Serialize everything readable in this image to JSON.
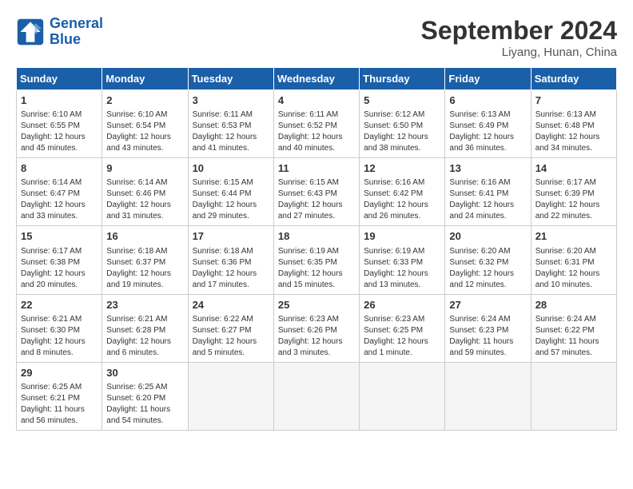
{
  "header": {
    "logo_line1": "General",
    "logo_line2": "Blue",
    "month_title": "September 2024",
    "location": "Liyang, Hunan, China"
  },
  "days_of_week": [
    "Sunday",
    "Monday",
    "Tuesday",
    "Wednesday",
    "Thursday",
    "Friday",
    "Saturday"
  ],
  "weeks": [
    [
      {
        "day": "1",
        "info": "Sunrise: 6:10 AM\nSunset: 6:55 PM\nDaylight: 12 hours\nand 45 minutes."
      },
      {
        "day": "2",
        "info": "Sunrise: 6:10 AM\nSunset: 6:54 PM\nDaylight: 12 hours\nand 43 minutes."
      },
      {
        "day": "3",
        "info": "Sunrise: 6:11 AM\nSunset: 6:53 PM\nDaylight: 12 hours\nand 41 minutes."
      },
      {
        "day": "4",
        "info": "Sunrise: 6:11 AM\nSunset: 6:52 PM\nDaylight: 12 hours\nand 40 minutes."
      },
      {
        "day": "5",
        "info": "Sunrise: 6:12 AM\nSunset: 6:50 PM\nDaylight: 12 hours\nand 38 minutes."
      },
      {
        "day": "6",
        "info": "Sunrise: 6:13 AM\nSunset: 6:49 PM\nDaylight: 12 hours\nand 36 minutes."
      },
      {
        "day": "7",
        "info": "Sunrise: 6:13 AM\nSunset: 6:48 PM\nDaylight: 12 hours\nand 34 minutes."
      }
    ],
    [
      {
        "day": "8",
        "info": "Sunrise: 6:14 AM\nSunset: 6:47 PM\nDaylight: 12 hours\nand 33 minutes."
      },
      {
        "day": "9",
        "info": "Sunrise: 6:14 AM\nSunset: 6:46 PM\nDaylight: 12 hours\nand 31 minutes."
      },
      {
        "day": "10",
        "info": "Sunrise: 6:15 AM\nSunset: 6:44 PM\nDaylight: 12 hours\nand 29 minutes."
      },
      {
        "day": "11",
        "info": "Sunrise: 6:15 AM\nSunset: 6:43 PM\nDaylight: 12 hours\nand 27 minutes."
      },
      {
        "day": "12",
        "info": "Sunrise: 6:16 AM\nSunset: 6:42 PM\nDaylight: 12 hours\nand 26 minutes."
      },
      {
        "day": "13",
        "info": "Sunrise: 6:16 AM\nSunset: 6:41 PM\nDaylight: 12 hours\nand 24 minutes."
      },
      {
        "day": "14",
        "info": "Sunrise: 6:17 AM\nSunset: 6:39 PM\nDaylight: 12 hours\nand 22 minutes."
      }
    ],
    [
      {
        "day": "15",
        "info": "Sunrise: 6:17 AM\nSunset: 6:38 PM\nDaylight: 12 hours\nand 20 minutes."
      },
      {
        "day": "16",
        "info": "Sunrise: 6:18 AM\nSunset: 6:37 PM\nDaylight: 12 hours\nand 19 minutes."
      },
      {
        "day": "17",
        "info": "Sunrise: 6:18 AM\nSunset: 6:36 PM\nDaylight: 12 hours\nand 17 minutes."
      },
      {
        "day": "18",
        "info": "Sunrise: 6:19 AM\nSunset: 6:35 PM\nDaylight: 12 hours\nand 15 minutes."
      },
      {
        "day": "19",
        "info": "Sunrise: 6:19 AM\nSunset: 6:33 PM\nDaylight: 12 hours\nand 13 minutes."
      },
      {
        "day": "20",
        "info": "Sunrise: 6:20 AM\nSunset: 6:32 PM\nDaylight: 12 hours\nand 12 minutes."
      },
      {
        "day": "21",
        "info": "Sunrise: 6:20 AM\nSunset: 6:31 PM\nDaylight: 12 hours\nand 10 minutes."
      }
    ],
    [
      {
        "day": "22",
        "info": "Sunrise: 6:21 AM\nSunset: 6:30 PM\nDaylight: 12 hours\nand 8 minutes."
      },
      {
        "day": "23",
        "info": "Sunrise: 6:21 AM\nSunset: 6:28 PM\nDaylight: 12 hours\nand 6 minutes."
      },
      {
        "day": "24",
        "info": "Sunrise: 6:22 AM\nSunset: 6:27 PM\nDaylight: 12 hours\nand 5 minutes."
      },
      {
        "day": "25",
        "info": "Sunrise: 6:23 AM\nSunset: 6:26 PM\nDaylight: 12 hours\nand 3 minutes."
      },
      {
        "day": "26",
        "info": "Sunrise: 6:23 AM\nSunset: 6:25 PM\nDaylight: 12 hours\nand 1 minute."
      },
      {
        "day": "27",
        "info": "Sunrise: 6:24 AM\nSunset: 6:23 PM\nDaylight: 11 hours\nand 59 minutes."
      },
      {
        "day": "28",
        "info": "Sunrise: 6:24 AM\nSunset: 6:22 PM\nDaylight: 11 hours\nand 57 minutes."
      }
    ],
    [
      {
        "day": "29",
        "info": "Sunrise: 6:25 AM\nSunset: 6:21 PM\nDaylight: 11 hours\nand 56 minutes."
      },
      {
        "day": "30",
        "info": "Sunrise: 6:25 AM\nSunset: 6:20 PM\nDaylight: 11 hours\nand 54 minutes."
      },
      {
        "day": "",
        "info": ""
      },
      {
        "day": "",
        "info": ""
      },
      {
        "day": "",
        "info": ""
      },
      {
        "day": "",
        "info": ""
      },
      {
        "day": "",
        "info": ""
      }
    ]
  ]
}
